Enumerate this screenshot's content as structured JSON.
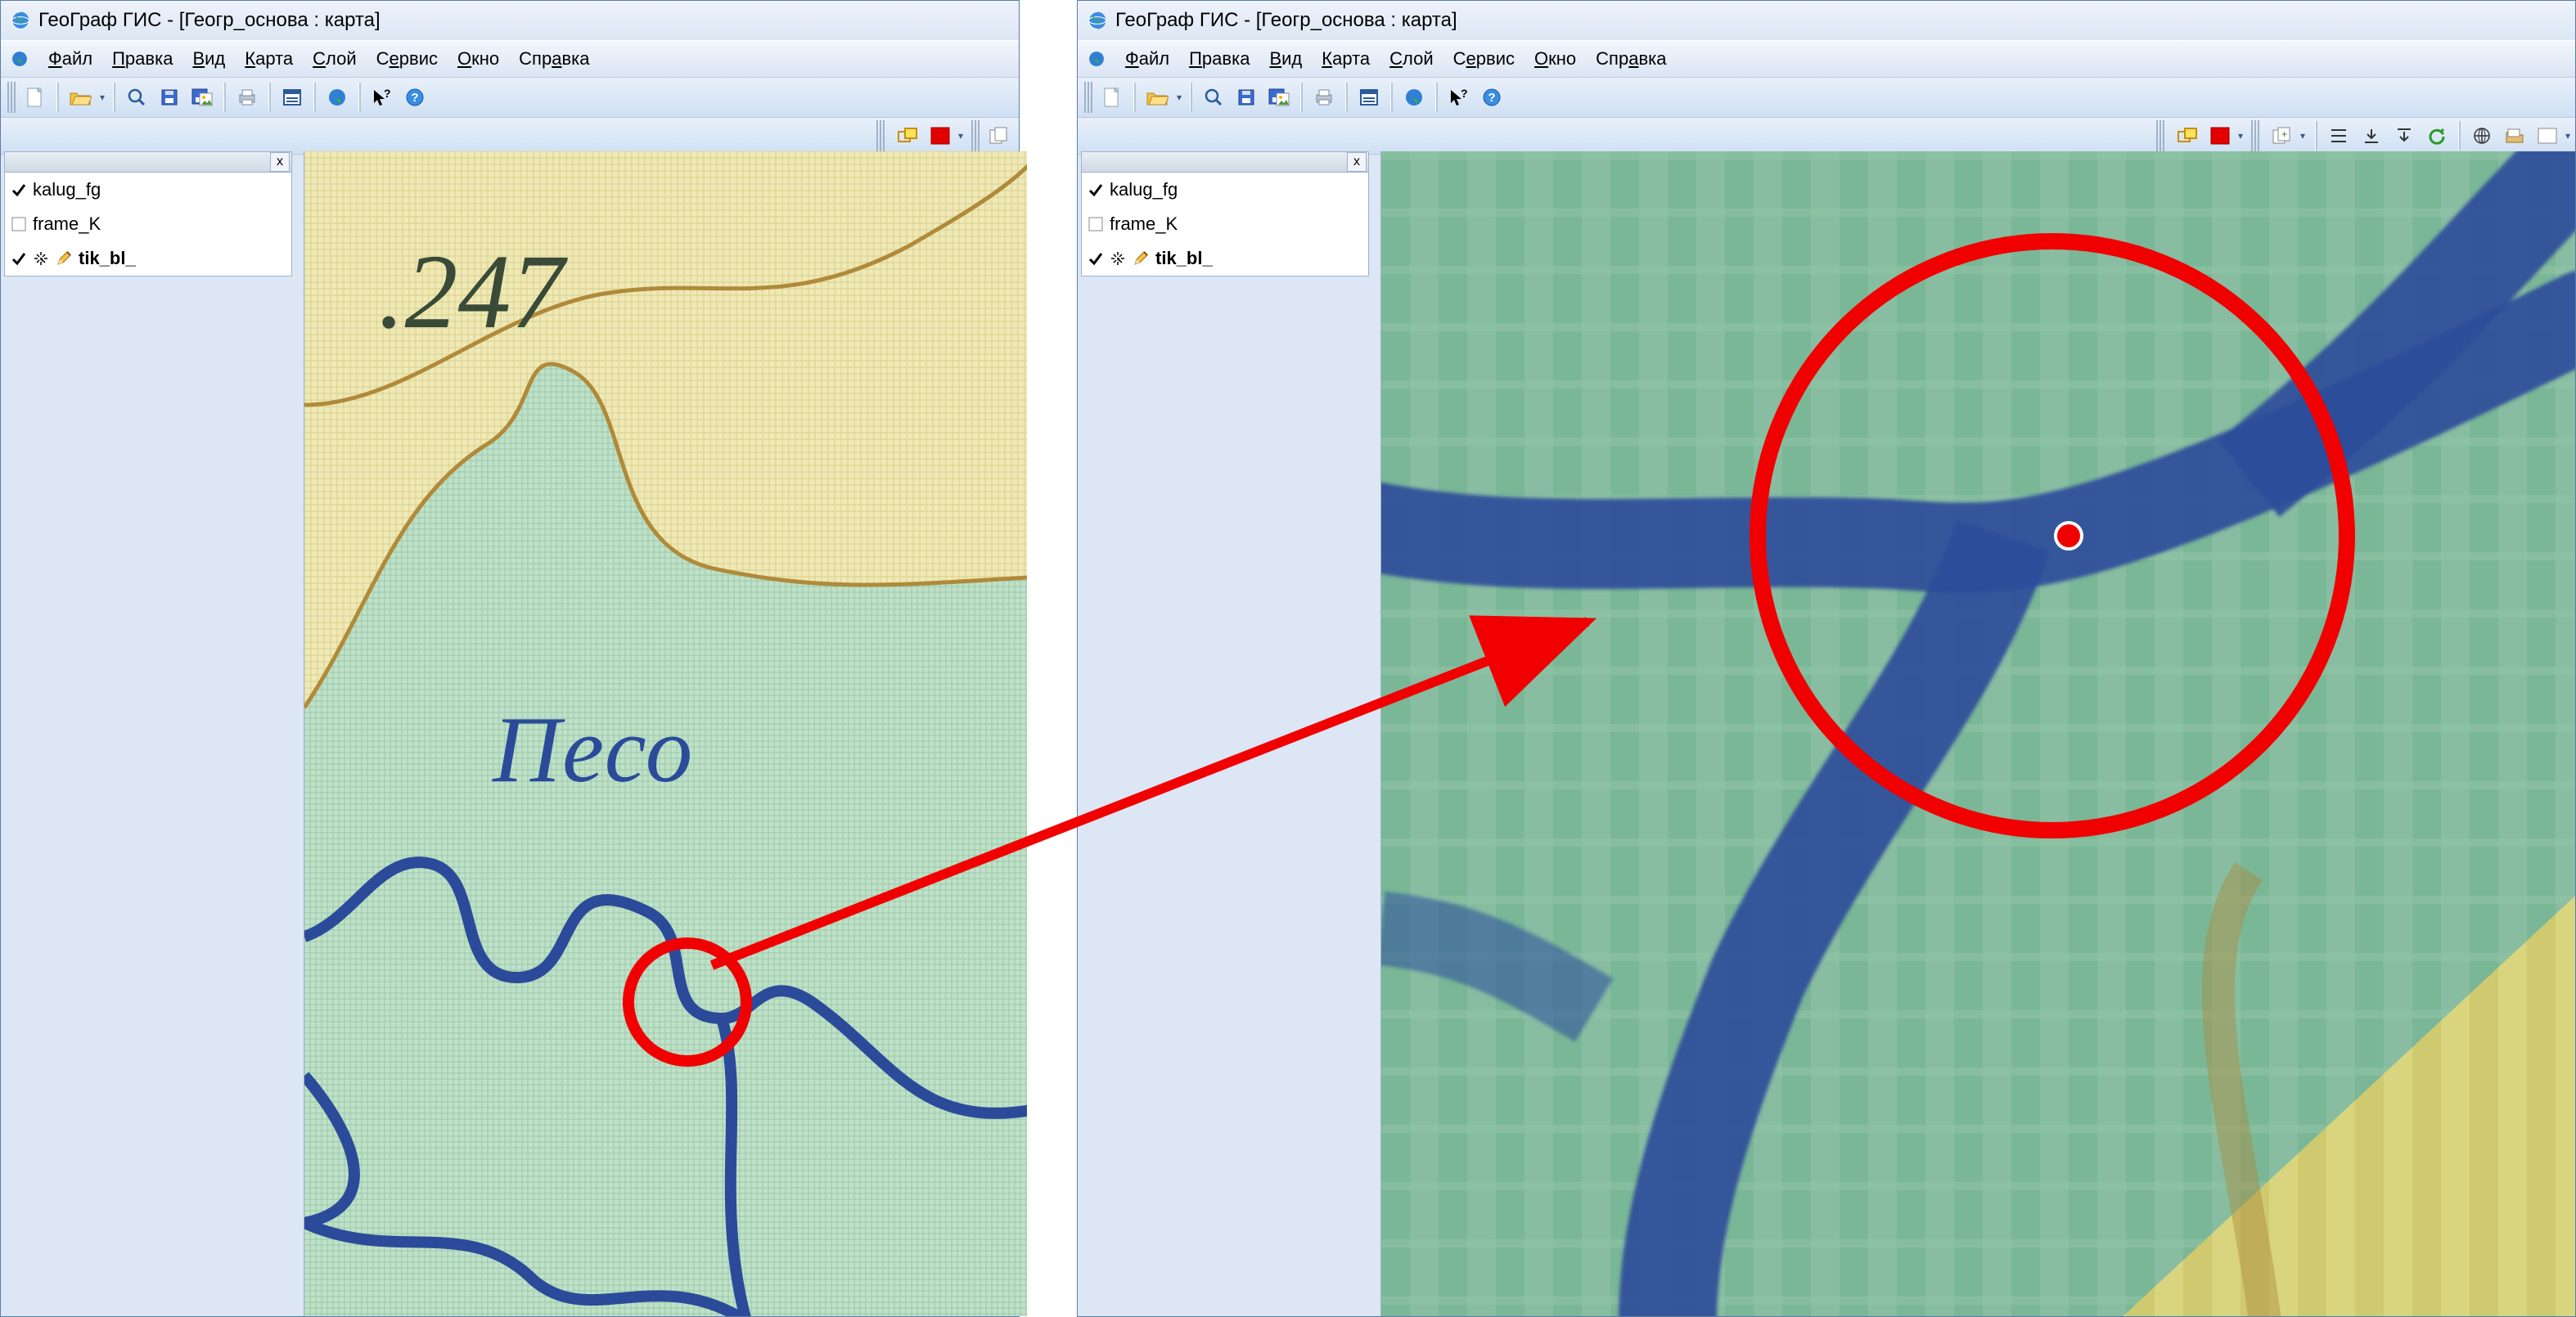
{
  "app": {
    "title": "ГеоГраф ГИС - [Геогр_основа : карта]"
  },
  "menu": {
    "items": [
      {
        "pre": "",
        "u": "Ф",
        "post": "айл"
      },
      {
        "pre": "",
        "u": "П",
        "post": "равка"
      },
      {
        "pre": "",
        "u": "В",
        "post": "ид"
      },
      {
        "pre": "",
        "u": "К",
        "post": "арта"
      },
      {
        "pre": "",
        "u": "С",
        "post": "лой"
      },
      {
        "pre": "С",
        "u": "е",
        "post": "рвис"
      },
      {
        "pre": "",
        "u": "О",
        "post": "кно"
      },
      {
        "pre": "Спр",
        "u": "а",
        "post": "вка"
      }
    ]
  },
  "toolbar1_icons": [
    "new-doc",
    "open",
    "zoom",
    "save",
    "save-image",
    "print",
    "window-list",
    "globe",
    "cursor-help",
    "help"
  ],
  "toolbar2_left_icons": [
    "rect-yellow",
    "red-square"
  ],
  "toolbar2_right_icons": [
    "copy-plus",
    "align-left",
    "arrow-down",
    "arrow-down-under",
    "undo",
    "globe-lines",
    "folder-tan",
    "white-rect"
  ],
  "layers": {
    "items": [
      {
        "name": "kalug_fg",
        "checked": true,
        "bold": false,
        "icons": []
      },
      {
        "name": "frame_K",
        "checked": false,
        "bold": false,
        "icons": []
      },
      {
        "name": "tik_bl_",
        "checked": true,
        "bold": true,
        "icons": [
          "spark-cursor",
          "pencil"
        ]
      }
    ]
  },
  "map_left": {
    "elev_label": ".247",
    "text_label": "Песо"
  },
  "panel_close": "x"
}
